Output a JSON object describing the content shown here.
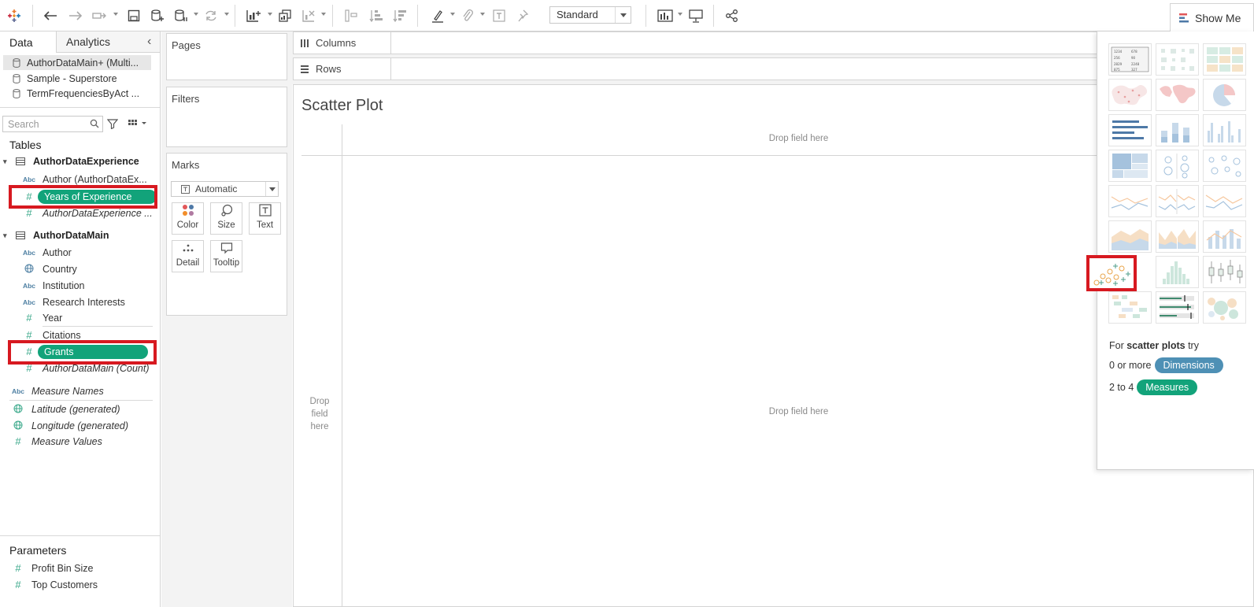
{
  "toolbar": {
    "marks_size_select": "Standard",
    "show_me_label": "Show Me"
  },
  "data_pane": {
    "tab_data": "Data",
    "tab_analytics": "Analytics",
    "data_sources": [
      {
        "label": "AuthorDataMain+ (Multi..."
      },
      {
        "label": "Sample - Superstore"
      },
      {
        "label": "TermFrequenciesByAct ..."
      }
    ],
    "search_placeholder": "Search",
    "tables_header": "Tables",
    "table1": {
      "name": "AuthorDataExperience",
      "fields": [
        {
          "type_icon": "Abc",
          "label": "Author (AuthorDataEx..."
        },
        {
          "type_icon": "#",
          "label": "Years of Experience"
        },
        {
          "type_icon": "#",
          "label": "AuthorDataExperience ..."
        }
      ]
    },
    "table2": {
      "name": "AuthorDataMain",
      "fields": [
        {
          "type_icon": "Abc",
          "label": "Author"
        },
        {
          "type_icon": "globe",
          "label": "Country"
        },
        {
          "type_icon": "Abc",
          "label": "Institution"
        },
        {
          "type_icon": "Abc",
          "label": "Research Interests"
        },
        {
          "type_icon": "#",
          "label": "Year"
        },
        {
          "type_icon": "#",
          "label": "Citations"
        },
        {
          "type_icon": "#",
          "label": "Grants"
        },
        {
          "type_icon": "#",
          "label": "AuthorDataMain (Count)"
        }
      ]
    },
    "generated_fields": [
      {
        "type_icon": "Abc",
        "label": "Measure Names"
      },
      {
        "type_icon": "globe",
        "label": "Latitude (generated)"
      },
      {
        "type_icon": "globe",
        "label": "Longitude (generated)"
      },
      {
        "type_icon": "#",
        "label": "Measure Values"
      }
    ],
    "parameters_header": "Parameters",
    "parameters": [
      {
        "type_icon": "#",
        "label": "Profit Bin Size"
      },
      {
        "type_icon": "#",
        "label": "Top Customers"
      }
    ]
  },
  "cards": {
    "pages": "Pages",
    "filters": "Filters",
    "marks": "Marks",
    "mark_type": "Automatic",
    "mark_buttons": [
      "Color",
      "Size",
      "Text",
      "Detail",
      "Tooltip"
    ]
  },
  "shelves": {
    "columns": "Columns",
    "rows": "Rows"
  },
  "view": {
    "title": "Scatter Plot",
    "drop_top": "Drop field here",
    "drop_center": "Drop field here",
    "drop_left": [
      "Drop",
      "field",
      "here"
    ]
  },
  "show_me": {
    "hint_prefix": "For",
    "hint_chart": "scatter plots",
    "hint_suffix": "try",
    "dim_prefix": "0 or more",
    "dim_chip": "Dimensions",
    "meas_prefix": "2 to 4",
    "meas_chip": "Measures",
    "selected_chart": "scatter plot"
  },
  "colors": {
    "measure_pill": "#12a37a",
    "dimension_chip": "#4e90b5",
    "highlight_box": "#d71920"
  }
}
